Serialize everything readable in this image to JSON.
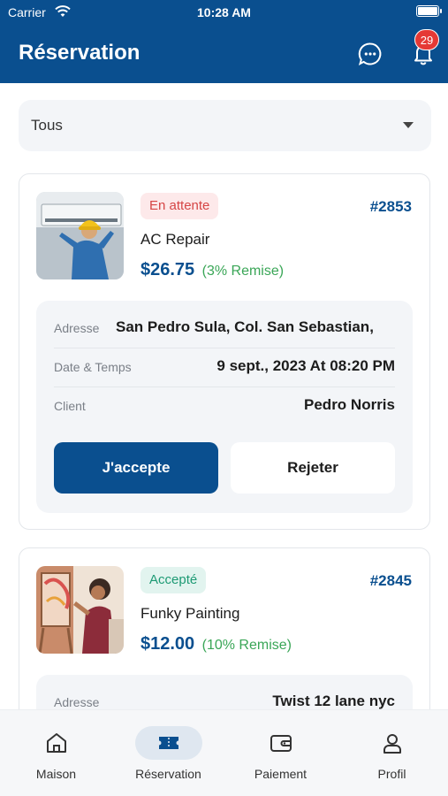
{
  "status_bar": {
    "carrier": "Carrier",
    "time": "10:28 AM"
  },
  "header": {
    "title": "Réservation",
    "notification_count": "29"
  },
  "filter": {
    "selected": "Tous"
  },
  "bookings": [
    {
      "status": "En attente",
      "id": "#2853",
      "service": "AC Repair",
      "price": "$26.75",
      "discount": "(3% Remise)",
      "address_label": "Adresse",
      "address": "San Pedro Sula, Col. San Sebastian,",
      "datetime_label": "Date & Temps",
      "datetime": "9 sept., 2023 At 08:20 PM",
      "client_label": "Client",
      "client": "Pedro Norris",
      "accept_label": "J'accepte",
      "reject_label": "Rejeter"
    },
    {
      "status": "Accepté",
      "id": "#2845",
      "service": "Funky Painting",
      "price": "$12.00",
      "discount": "(10% Remise)",
      "address_label": "Adresse",
      "address": "Twist 12 lane nyc"
    }
  ],
  "nav": [
    {
      "label": "Maison",
      "icon": "home-icon"
    },
    {
      "label": "Réservation",
      "icon": "ticket-icon",
      "active": true
    },
    {
      "label": "Paiement",
      "icon": "wallet-icon"
    },
    {
      "label": "Profil",
      "icon": "profile-icon"
    }
  ],
  "colors": {
    "primary": "#0a4f8f",
    "pending_text": "#d64545",
    "pending_bg": "#fde9ea",
    "accepted_text": "#1d9a74",
    "accepted_bg": "#e2f4ef",
    "discount": "#3aa657",
    "badge": "#e53935"
  }
}
